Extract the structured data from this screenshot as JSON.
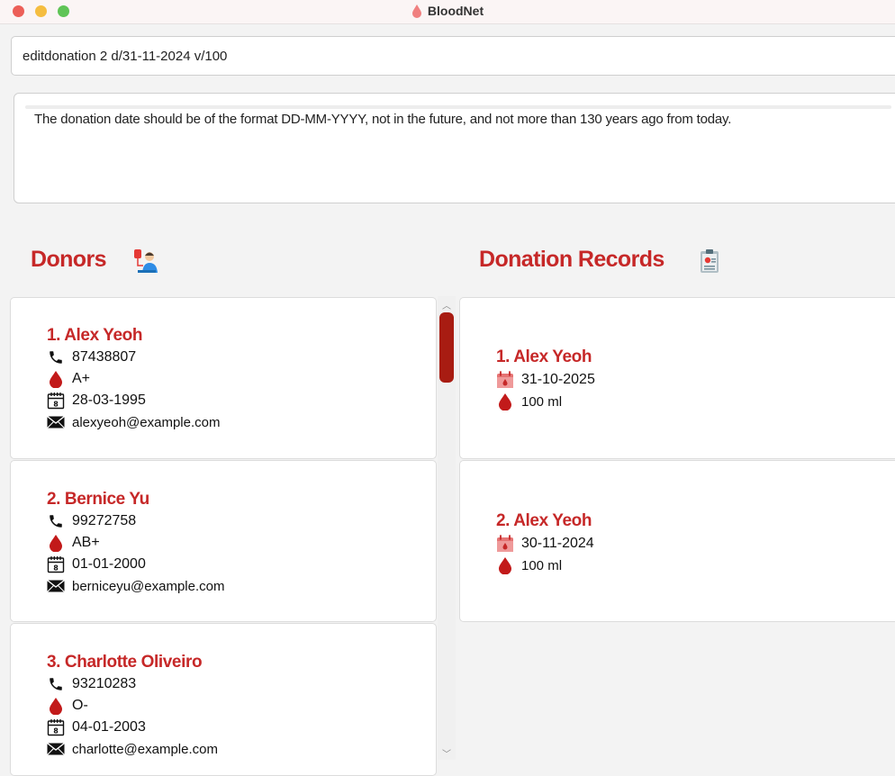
{
  "window": {
    "title": "BloodNet"
  },
  "command": {
    "value": "editdonation 2 d/31-11-2024 v/100"
  },
  "result": {
    "message": "The donation date should be of the format DD-MM-YYYY, not in the future, and not more than 130 years ago from today."
  },
  "donors": {
    "title": "Donors",
    "items": [
      {
        "name": "1. Alex Yeoh",
        "phone": "87438807",
        "blood": "A+",
        "dob": "28-03-1995",
        "email": "alexyeoh@example.com"
      },
      {
        "name": "2. Bernice Yu",
        "phone": "99272758",
        "blood": "AB+",
        "dob": "01-01-2000",
        "email": "berniceyu@example.com"
      },
      {
        "name": "3. Charlotte Oliveiro",
        "phone": "93210283",
        "blood": "O-",
        "dob": "04-01-2003",
        "email": "charlotte@example.com"
      }
    ]
  },
  "records": {
    "title": "Donation Records",
    "items": [
      {
        "name": "1. Alex Yeoh",
        "date": "31-10-2025",
        "volume": "100 ml"
      },
      {
        "name": "2. Alex Yeoh",
        "date": "30-11-2024",
        "volume": "100 ml"
      }
    ]
  },
  "colors": {
    "accent": "#c62828",
    "scrollbar_thumb": "#a81c12"
  },
  "icons": [
    "phone-icon",
    "blood-drop-icon",
    "calendar-icon",
    "envelope-icon",
    "blood-calendar-icon"
  ]
}
